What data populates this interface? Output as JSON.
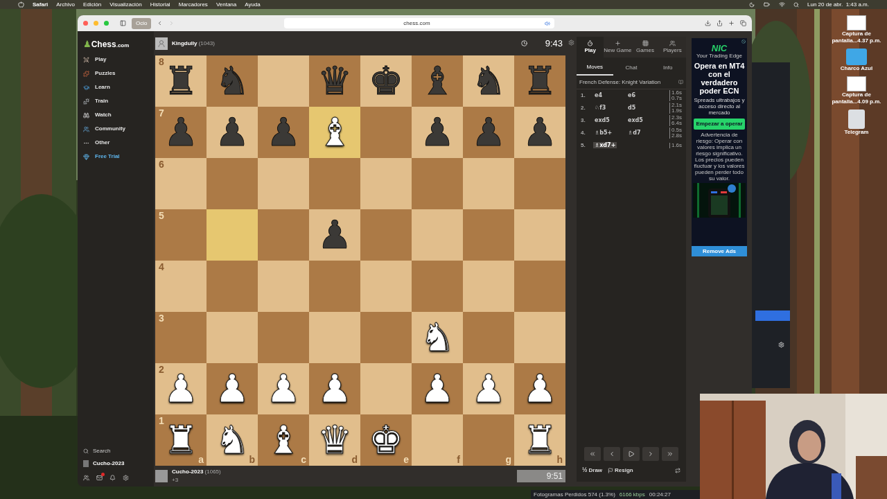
{
  "menu_bar": {
    "app": "Safari",
    "items": [
      "Archivo",
      "Edición",
      "Visualización",
      "Historial",
      "Marcadores",
      "Ventana",
      "Ayuda"
    ],
    "clock": "Lun 20 de abr.  1:43 a.m."
  },
  "desktop_icons": [
    {
      "label": "Captura de pantalla...4.37 p.m.",
      "kind": "screenshot"
    },
    {
      "label": "Charco Azul",
      "kind": "folder"
    },
    {
      "label": "Captura de pantalla...4.09 p.m.",
      "kind": "screenshot"
    },
    {
      "label": "Telegram",
      "kind": "drive"
    }
  ],
  "browser": {
    "tab_group": "Ocio",
    "url": "chess.com"
  },
  "sidebar": {
    "logo_icon": "♟",
    "logo": "Chess",
    "logo_suffix": ".com",
    "items": [
      {
        "label": "Play",
        "kind": "link"
      },
      {
        "label": "Puzzles",
        "kind": "link"
      },
      {
        "label": "Learn",
        "kind": "link"
      },
      {
        "label": "Train",
        "kind": "link"
      },
      {
        "label": "Watch",
        "kind": "link"
      },
      {
        "label": "Community",
        "kind": "link"
      },
      {
        "label": "Other",
        "kind": "link"
      },
      {
        "label": "Free Trial",
        "kind": "promo"
      }
    ],
    "search": "Search",
    "user": "Cucho-2023"
  },
  "top_player": {
    "name": "Kingdully",
    "rating": "(1043)",
    "clock": "9:43"
  },
  "bottom_player": {
    "name": "Cucho-2023",
    "rating": "(1065)",
    "captured": "+3",
    "clock": "9:51"
  },
  "board": {
    "ranks": [
      "8",
      "7",
      "6",
      "5",
      "4",
      "3",
      "2",
      "1"
    ],
    "files": [
      "a",
      "b",
      "c",
      "d",
      "e",
      "f",
      "g",
      "h"
    ],
    "rows": [
      [
        {
          "piece": "♜",
          "white": false,
          "highlighted": false
        },
        {
          "piece": "♞",
          "white": false,
          "highlighted": false
        },
        {
          "highlighted": false
        },
        {
          "piece": "♛",
          "white": false,
          "highlighted": false
        },
        {
          "piece": "♚",
          "white": false,
          "highlighted": false
        },
        {
          "piece": "♝",
          "white": false,
          "highlighted": false
        },
        {
          "piece": "♞",
          "white": false,
          "highlighted": false
        },
        {
          "piece": "♜",
          "white": false,
          "highlighted": false
        }
      ],
      [
        {
          "piece": "♟",
          "white": false,
          "highlighted": false
        },
        {
          "piece": "♟",
          "white": false,
          "highlighted": false
        },
        {
          "piece": "♟",
          "white": false,
          "highlighted": false
        },
        {
          "piece": "♝",
          "white": true,
          "highlighted": true
        },
        {
          "highlighted": false
        },
        {
          "piece": "♟",
          "white": false,
          "highlighted": false
        },
        {
          "piece": "♟",
          "white": false,
          "highlighted": false
        },
        {
          "piece": "♟",
          "white": false,
          "highlighted": false
        }
      ],
      [
        {
          "highlighted": false
        },
        {
          "highlighted": false
        },
        {
          "highlighted": false
        },
        {
          "highlighted": false
        },
        {
          "highlighted": false
        },
        {
          "highlighted": false
        },
        {
          "highlighted": false
        },
        {
          "highlighted": false
        }
      ],
      [
        {
          "highlighted": false
        },
        {
          "highlighted": true
        },
        {
          "highlighted": false
        },
        {
          "piece": "♟",
          "white": false,
          "highlighted": false
        },
        {
          "highlighted": false
        },
        {
          "highlighted": false
        },
        {
          "highlighted": false
        },
        {
          "highlighted": false
        }
      ],
      [
        {
          "highlighted": false
        },
        {
          "highlighted": false
        },
        {
          "highlighted": false
        },
        {
          "highlighted": false
        },
        {
          "highlighted": false
        },
        {
          "highlighted": false
        },
        {
          "highlighted": false
        },
        {
          "highlighted": false
        }
      ],
      [
        {
          "highlighted": false
        },
        {
          "highlighted": false
        },
        {
          "highlighted": false
        },
        {
          "highlighted": false
        },
        {
          "highlighted": false
        },
        {
          "piece": "♞",
          "white": true,
          "highlighted": false
        },
        {
          "highlighted": false
        },
        {
          "highlighted": false
        }
      ],
      [
        {
          "piece": "♟",
          "white": true,
          "highlighted": false
        },
        {
          "piece": "♟",
          "white": true,
          "highlighted": false
        },
        {
          "piece": "♟",
          "white": true,
          "highlighted": false
        },
        {
          "piece": "♟",
          "white": true,
          "highlighted": false
        },
        {
          "highlighted": false
        },
        {
          "piece": "♟",
          "white": true,
          "highlighted": false
        },
        {
          "piece": "♟",
          "white": true,
          "highlighted": false
        },
        {
          "piece": "♟",
          "white": true,
          "highlighted": false
        }
      ],
      [
        {
          "piece": "♜",
          "white": true,
          "highlighted": false
        },
        {
          "piece": "♞",
          "white": true,
          "highlighted": false
        },
        {
          "piece": "♝",
          "white": true,
          "highlighted": false
        },
        {
          "piece": "♛",
          "white": true,
          "highlighted": false
        },
        {
          "piece": "♚",
          "white": true,
          "highlighted": false
        },
        {
          "highlighted": false
        },
        {
          "highlighted": false
        },
        {
          "piece": "♜",
          "white": true,
          "highlighted": false
        }
      ]
    ]
  },
  "panel": {
    "top_tabs": [
      {
        "label": "Play",
        "selected": true
      },
      {
        "label": "New Game",
        "selected": false
      },
      {
        "label": "Games",
        "selected": false
      },
      {
        "label": "Players",
        "selected": false
      }
    ],
    "tabs": [
      {
        "label": "Moves",
        "selected": true
      },
      {
        "label": "Chat",
        "selected": false
      },
      {
        "label": "Info",
        "selected": false
      }
    ],
    "opening": "French Defense: Knight Variation",
    "moves": [
      {
        "number": "1.",
        "white": "e4",
        "black": "e6",
        "times": [
          "1.6s",
          "0.7s"
        ],
        "selected": false
      },
      {
        "number": "2.",
        "white": "♘f3",
        "black": "d5",
        "times": [
          "2.1s",
          "1.9s"
        ],
        "selected": false
      },
      {
        "number": "3.",
        "white": "exd5",
        "black": "exd5",
        "times": [
          "2.3s",
          "6.4s"
        ],
        "selected": false
      },
      {
        "number": "4.",
        "white": "♗b5+",
        "black": "♗d7",
        "times": [
          "0.5s",
          "2.8s"
        ],
        "selected": false
      },
      {
        "number": "5.",
        "white": "♗xd7+",
        "times": [
          "1.6s"
        ],
        "selected": true
      }
    ],
    "draw": "Draw",
    "draw_symbol": "½",
    "resign": "Resign"
  },
  "ad": {
    "logo": "NIC",
    "tagline": "Your Trading Edge",
    "headline": "Opera en MT4 con el verdadero poder ECN",
    "subline": "Spreads ultrabajos y acceso directo al mercado",
    "cta": "Empezar a operar",
    "disclaimer": "Advertencia de riesgo: Operar con valores implica un riesgo significativo. Los precios pueden fluctuar y los valores pueden perder todo su valor.",
    "remove": "Remove Ads"
  },
  "stream_stats": {
    "dropped": "Fotogramas Perdidos 574 (1.3%)",
    "bitrate": "6166 kbps",
    "time": "00:24:27"
  }
}
